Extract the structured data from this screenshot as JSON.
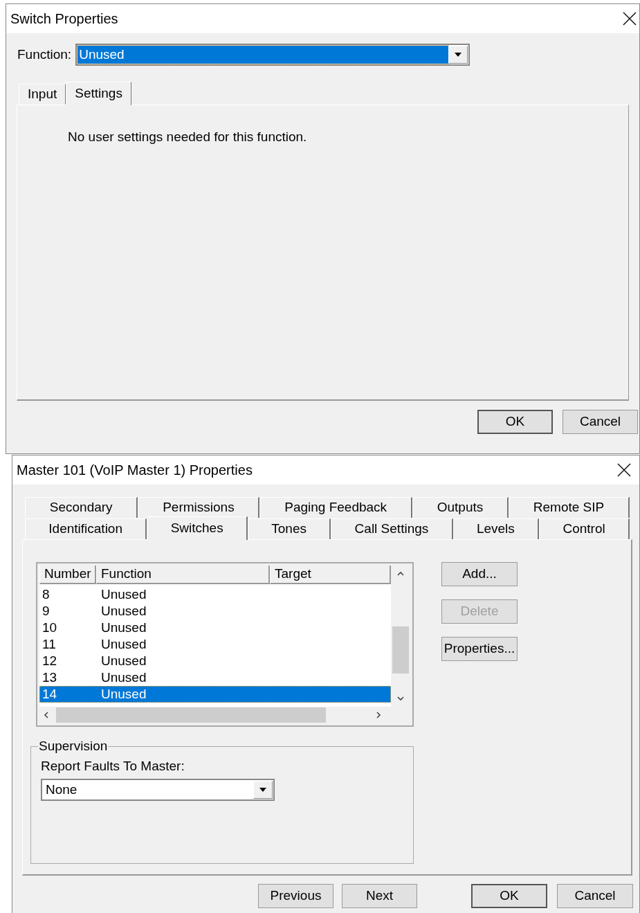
{
  "switch_dialog": {
    "title": "Switch Properties",
    "function_label": "Function:",
    "function_value": "Unused",
    "function_focused": true,
    "tabs": [
      {
        "label": "Input",
        "selected": false
      },
      {
        "label": "Settings",
        "selected": true
      }
    ],
    "message": "No user settings needed for this function.",
    "buttons": [
      {
        "label": "OK",
        "default": true
      },
      {
        "label": "Cancel",
        "default": false
      }
    ]
  },
  "master_dialog": {
    "title": "Master 101 (VoIP Master 1) Properties",
    "tab_rows": [
      {
        "tabs": [
          {
            "label": "Secondary",
            "selected": false
          },
          {
            "label": "Permissions",
            "selected": false
          },
          {
            "label": "Paging Feedback",
            "selected": false
          },
          {
            "label": "Outputs",
            "selected": false
          },
          {
            "label": "Remote SIP",
            "selected": false
          }
        ]
      },
      {
        "tabs": [
          {
            "label": "Identification",
            "selected": false
          },
          {
            "label": "Switches",
            "selected": true
          },
          {
            "label": "Tones",
            "selected": false
          },
          {
            "label": "Call Settings",
            "selected": false
          },
          {
            "label": "Levels",
            "selected": false
          },
          {
            "label": "Control",
            "selected": false
          }
        ]
      }
    ],
    "table": {
      "columns": [
        "Number",
        "Function",
        "Target"
      ],
      "rows": [
        {
          "number": "8",
          "function": "Unused",
          "selected": false
        },
        {
          "number": "9",
          "function": "Unused",
          "selected": false
        },
        {
          "number": "10",
          "function": "Unused",
          "selected": false
        },
        {
          "number": "11",
          "function": "Unused",
          "selected": false
        },
        {
          "number": "12",
          "function": "Unused",
          "selected": false
        },
        {
          "number": "13",
          "function": "Unused",
          "selected": false
        },
        {
          "number": "14",
          "function": "Unused",
          "selected": true
        }
      ]
    },
    "side_buttons": [
      {
        "label": "Add...",
        "disabled": false
      },
      {
        "label": "Delete",
        "disabled": true
      },
      {
        "label": "Properties...",
        "disabled": false
      }
    ],
    "supervision": {
      "title": "Supervision",
      "report_label": "Report Faults To Master:",
      "report_value": "None"
    },
    "buttons": [
      {
        "label": "Previous",
        "default": false
      },
      {
        "label": "Next",
        "default": false
      },
      {
        "label": "OK",
        "default": true
      },
      {
        "label": "Cancel",
        "default": false
      }
    ]
  }
}
